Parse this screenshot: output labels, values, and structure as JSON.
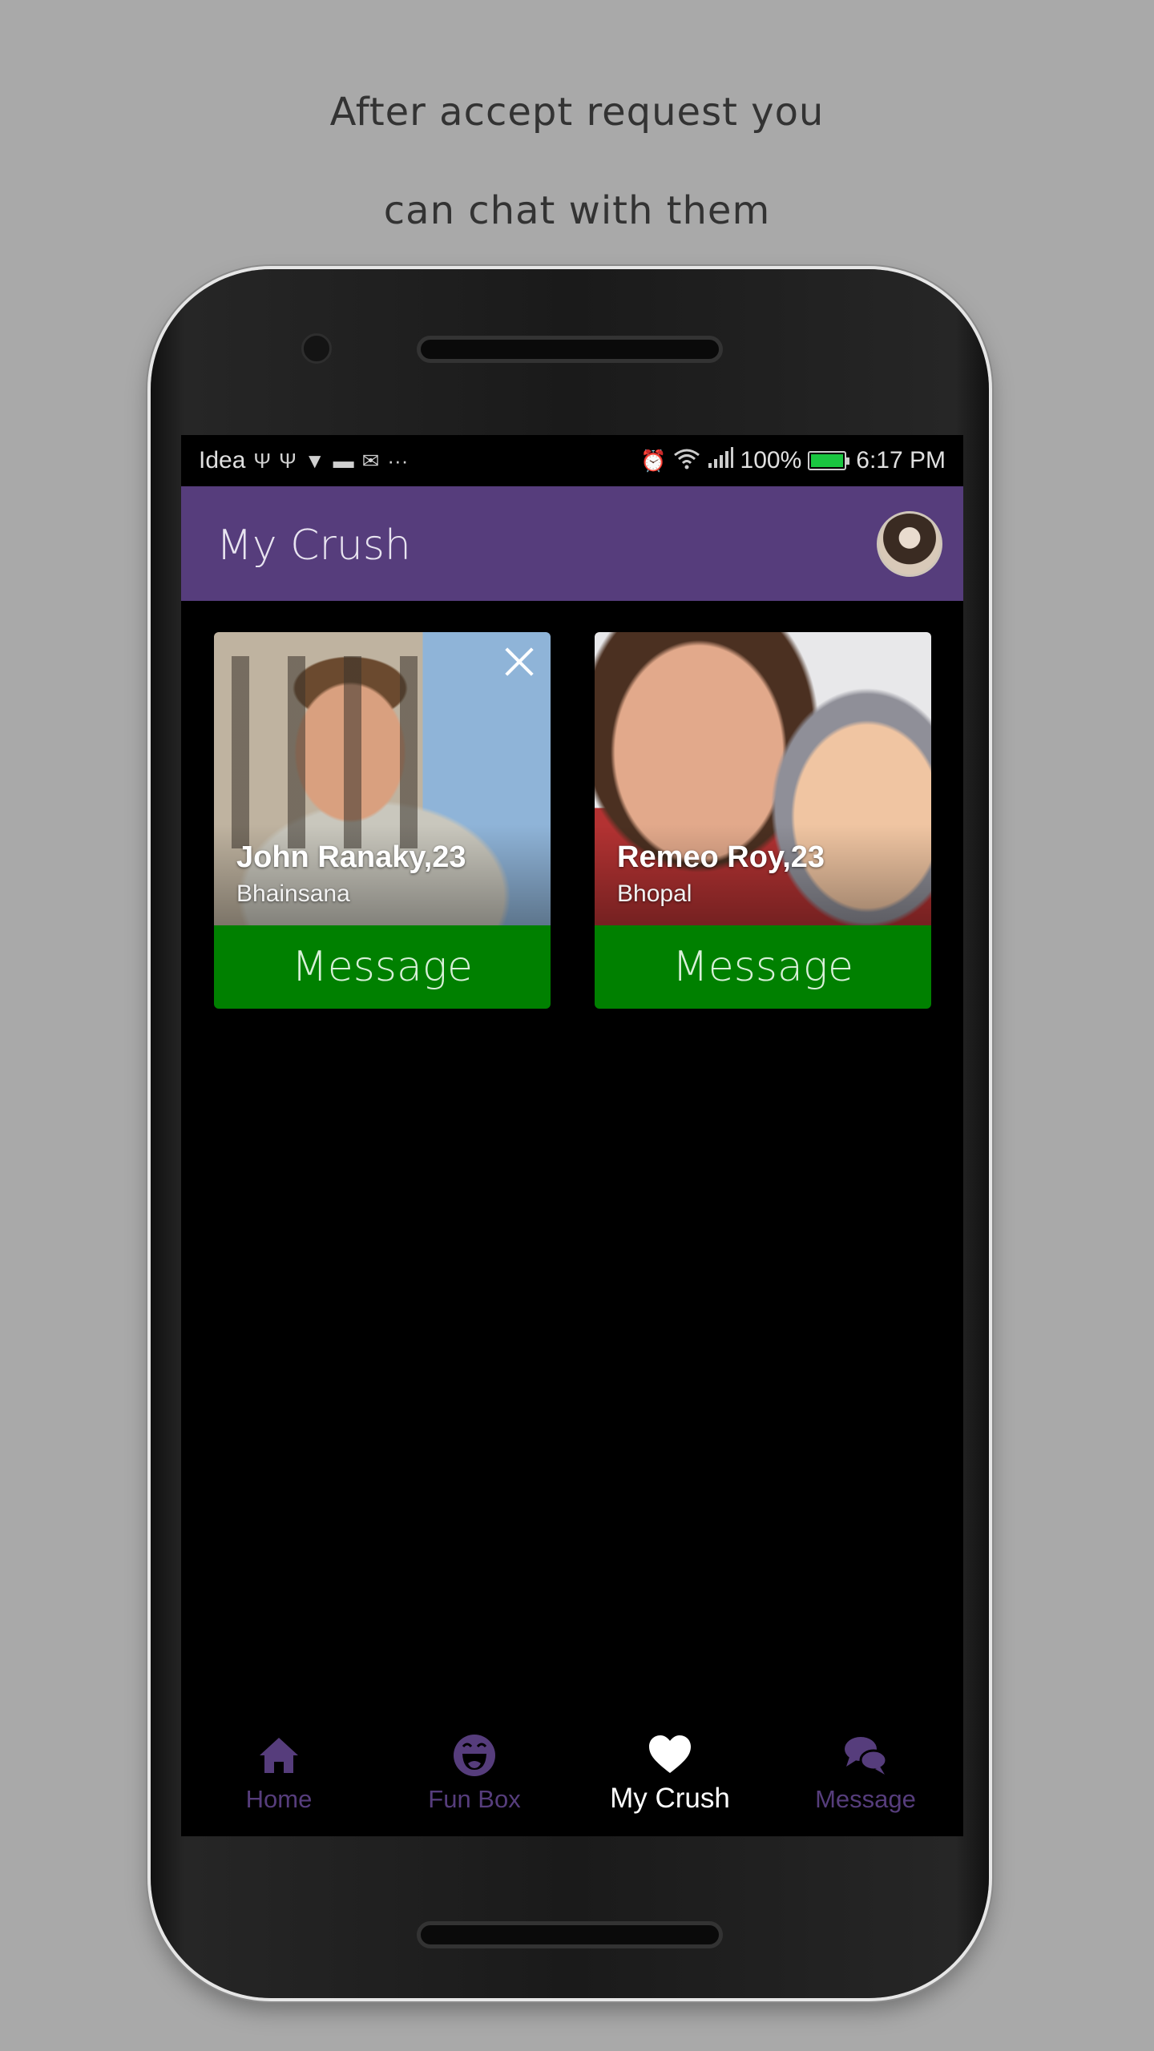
{
  "promo": {
    "line1": "After accept request you",
    "line2": "can chat with them"
  },
  "status_bar": {
    "carrier": "Idea",
    "notification_icons": [
      "usb-icon",
      "usb-icon",
      "download-icon",
      "paytm-icon",
      "gmail-icon"
    ],
    "overflow": "···",
    "battery": "100%",
    "time": "6:17 PM"
  },
  "app_bar": {
    "title": "My Crush"
  },
  "cards": [
    {
      "name": "John Ranaky,23",
      "city": "Bhainsana",
      "action": "Message",
      "has_close": true
    },
    {
      "name": "Remeo Roy,23",
      "city": "Bhopal",
      "action": "Message",
      "has_close": false
    }
  ],
  "bottom_nav": {
    "items": [
      {
        "label": "Home",
        "icon": "home-icon",
        "active": false
      },
      {
        "label": "Fun Box",
        "icon": "smiley-icon",
        "active": false
      },
      {
        "label": "My Crush",
        "icon": "heart-icon",
        "active": true
      },
      {
        "label": "Message",
        "icon": "chat-bubbles-icon",
        "active": false
      }
    ]
  },
  "colors": {
    "background": "#a9a9a9",
    "app_bar": "#563d7c",
    "message_button": "#008000",
    "nav_inactive": "#563d7c",
    "nav_active": "#ffffff",
    "battery": "#19c640"
  }
}
